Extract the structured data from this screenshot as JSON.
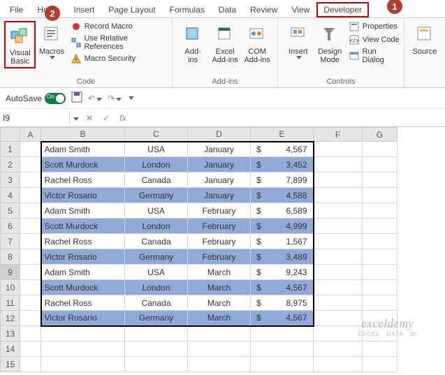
{
  "callouts": {
    "one": "1",
    "two": "2"
  },
  "tabs": [
    "File",
    "Home",
    "Insert",
    "Page Layout",
    "Formulas",
    "Data",
    "Review",
    "View",
    "Developer"
  ],
  "ribbon": {
    "visual_basic": "Visual\nBasic",
    "macros": "Macros",
    "record_macro": "Record Macro",
    "use_rel_refs": "Use Relative References",
    "macro_security": "Macro Security",
    "code_group": "Code",
    "addins": "Add-\nins",
    "excel_addins": "Excel\nAdd-ins",
    "com_addins": "COM\nAdd-ins",
    "addins_group": "Add-ins",
    "insert_ctrl": "Insert",
    "design_mode": "Design\nMode",
    "properties": "Properties",
    "view_code": "View Code",
    "run_dialog": "Run Dialog",
    "controls_group": "Controls",
    "source": "Source"
  },
  "qat": {
    "autosave": "AutoSave",
    "on": "On"
  },
  "namebox": {
    "ref": "I9",
    "fx": "fx"
  },
  "columns": [
    "A",
    "B",
    "C",
    "D",
    "E",
    "F",
    "G"
  ],
  "rows_visible": [
    "1",
    "2",
    "3",
    "4",
    "5",
    "6",
    "7",
    "8",
    "9",
    "10",
    "11",
    "12",
    "13",
    "14",
    "15"
  ],
  "active_cell": {
    "row": 9,
    "col": "I"
  },
  "table": {
    "rows": [
      {
        "name": "Adam Smith",
        "country": "USA",
        "month": "January",
        "sym": "$",
        "amt": "4,567",
        "shade": false
      },
      {
        "name": "Scott Murdock",
        "country": "London",
        "month": "January",
        "sym": "$",
        "amt": "3,452",
        "shade": true
      },
      {
        "name": "Rachel Ross",
        "country": "Canada",
        "month": "January",
        "sym": "$",
        "amt": "7,899",
        "shade": false
      },
      {
        "name": "Victor Rosario",
        "country": "Germany",
        "month": "January",
        "sym": "$",
        "amt": "4,588",
        "shade": true
      },
      {
        "name": "Adam Smith",
        "country": "USA",
        "month": "February",
        "sym": "$",
        "amt": "6,589",
        "shade": false
      },
      {
        "name": "Scott Murdock",
        "country": "London",
        "month": "February",
        "sym": "$",
        "amt": "4,999",
        "shade": true
      },
      {
        "name": "Rachel Ross",
        "country": "Canada",
        "month": "February",
        "sym": "$",
        "amt": "1,567",
        "shade": false
      },
      {
        "name": "Victor Rosario",
        "country": "Germany",
        "month": "February",
        "sym": "$",
        "amt": "3,489",
        "shade": true
      },
      {
        "name": "Adam Smith",
        "country": "USA",
        "month": "March",
        "sym": "$",
        "amt": "9,243",
        "shade": false
      },
      {
        "name": "Scott Murdock",
        "country": "London",
        "month": "March",
        "sym": "$",
        "amt": "4,567",
        "shade": true
      },
      {
        "name": "Rachel Ross",
        "country": "Canada",
        "month": "March",
        "sym": "$",
        "amt": "8,975",
        "shade": false
      },
      {
        "name": "Victor Rosario",
        "country": "Germany",
        "month": "March",
        "sym": "$",
        "amt": "4,567",
        "shade": true
      }
    ]
  },
  "watermark": {
    "line1": "exceldemy",
    "line2": "EXCEL · DATA · BI"
  }
}
